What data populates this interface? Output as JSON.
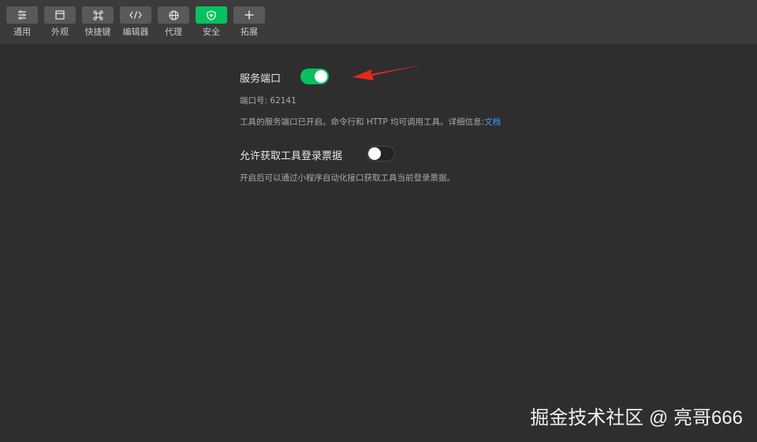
{
  "toolbar": {
    "items": [
      {
        "label": "通用",
        "icon": "general-settings-icon"
      },
      {
        "label": "外观",
        "icon": "appearance-icon"
      },
      {
        "label": "快捷键",
        "icon": "shortcut-icon"
      },
      {
        "label": "编辑器",
        "icon": "editor-code-icon"
      },
      {
        "label": "代理",
        "icon": "globe-icon"
      },
      {
        "label": "安全",
        "icon": "shield-icon"
      },
      {
        "label": "拓展",
        "icon": "plus-icon"
      }
    ],
    "active_index": 5,
    "active_color": "#07c160"
  },
  "security": {
    "service_port": {
      "title": "服务端口",
      "enabled": true,
      "port_label": "端口号:",
      "port_value": "62141",
      "desc": "工具的服务端口已开启。命令行和 HTTP 均可调用工具。详细信息:",
      "doc_link": "文档"
    },
    "login_ticket": {
      "title": "允许获取工具登录票据",
      "enabled": false,
      "desc": "开启后可以通过小程序自动化接口获取工具当前登录票据。"
    }
  },
  "annotation": {
    "arrow_color": "#e8261f"
  },
  "watermark": "掘金技术社区 @ 亮哥666"
}
